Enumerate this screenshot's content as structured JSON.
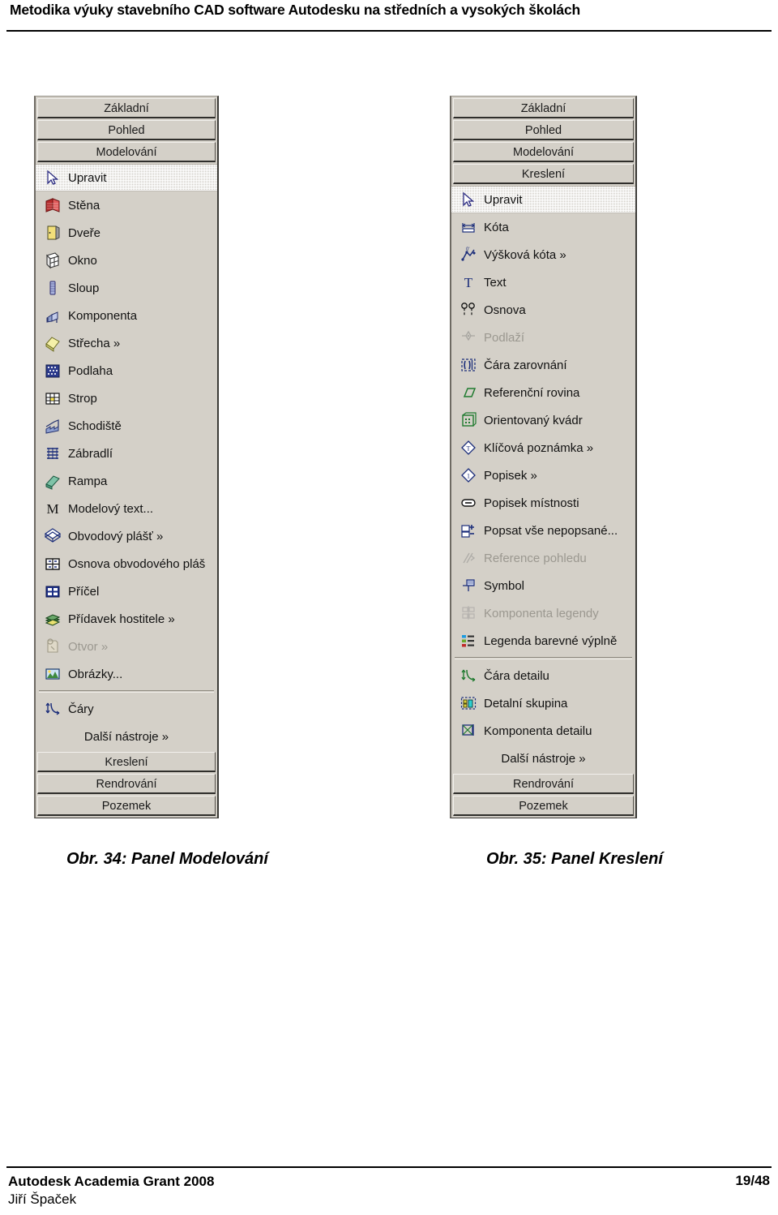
{
  "header": {
    "title": "Metodika výuky stavebního CAD software Autodesku na středních a vysokých školách"
  },
  "figures": [
    {
      "caption": "Obr. 34: Panel Modelování",
      "top_tabs": [
        "Základní",
        "Pohled",
        "Modelování"
      ],
      "bottom_tabs": [
        "Kreslení",
        "Rendrování",
        "Pozemek"
      ],
      "items": [
        {
          "label": "Upravit",
          "icon": "cursor-arrow-icon",
          "state": "selected"
        },
        {
          "label": "Stěna",
          "icon": "wall-icon",
          "state": "normal"
        },
        {
          "label": "Dveře",
          "icon": "door-icon",
          "state": "normal"
        },
        {
          "label": "Okno",
          "icon": "window-icon",
          "state": "normal"
        },
        {
          "label": "Sloup",
          "icon": "column-icon",
          "state": "normal"
        },
        {
          "label": "Komponenta",
          "icon": "component-icon",
          "state": "normal"
        },
        {
          "label": "Střecha »",
          "icon": "roof-icon",
          "state": "normal"
        },
        {
          "label": "Podlaha",
          "icon": "floor-icon",
          "state": "normal"
        },
        {
          "label": "Strop",
          "icon": "ceiling-icon",
          "state": "normal"
        },
        {
          "label": "Schodiště",
          "icon": "stairs-icon",
          "state": "normal"
        },
        {
          "label": "Zábradlí",
          "icon": "railing-icon",
          "state": "normal"
        },
        {
          "label": "Rampa",
          "icon": "ramp-icon",
          "state": "normal"
        },
        {
          "label": "Modelový text...",
          "icon": "model-text-icon",
          "state": "normal"
        },
        {
          "label": "Obvodový plášť »",
          "icon": "curtain-wall-icon",
          "state": "normal"
        },
        {
          "label": "Osnova obvodového pláš",
          "icon": "curtain-grid-icon",
          "state": "normal"
        },
        {
          "label": "Příčel",
          "icon": "mullion-icon",
          "state": "normal"
        },
        {
          "label": "Přídavek hostitele »",
          "icon": "host-sweep-icon",
          "state": "normal"
        },
        {
          "label": "Otvor »",
          "icon": "opening-icon",
          "state": "disabled"
        },
        {
          "label": "Obrázky...",
          "icon": "image-icon",
          "state": "normal"
        },
        {
          "label": "separator",
          "icon": "separator",
          "state": "separator"
        },
        {
          "label": "Čáry",
          "icon": "lines-icon",
          "state": "normal"
        },
        {
          "label": "Další nástroje »",
          "icon": "none",
          "state": "center"
        }
      ]
    },
    {
      "caption": "Obr. 35: Panel Kreslení",
      "top_tabs": [
        "Základní",
        "Pohled",
        "Modelování",
        "Kreslení"
      ],
      "bottom_tabs": [
        "Rendrování",
        "Pozemek"
      ],
      "items": [
        {
          "label": "Upravit",
          "icon": "cursor-arrow-icon",
          "state": "selected"
        },
        {
          "label": "Kóta",
          "icon": "dimension-icon",
          "state": "normal"
        },
        {
          "label": "Výšková kóta »",
          "icon": "spot-elevation-icon",
          "state": "normal"
        },
        {
          "label": "Text",
          "icon": "text-icon",
          "state": "normal"
        },
        {
          "label": "Osnova",
          "icon": "grid-icon",
          "state": "normal"
        },
        {
          "label": "Podlaží",
          "icon": "level-icon",
          "state": "disabled"
        },
        {
          "label": "Čára zarovnání",
          "icon": "alignment-line-icon",
          "state": "normal"
        },
        {
          "label": "Referenční rovina",
          "icon": "reference-plane-icon",
          "state": "normal"
        },
        {
          "label": "Orientovaný kvádr",
          "icon": "scope-box-icon",
          "state": "normal"
        },
        {
          "label": "Klíčová poznámka »",
          "icon": "keynote-icon",
          "state": "normal"
        },
        {
          "label": "Popisek »",
          "icon": "tag-icon",
          "state": "normal"
        },
        {
          "label": "Popisek místnosti",
          "icon": "room-tag-icon",
          "state": "normal"
        },
        {
          "label": "Popsat vše nepopsané...",
          "icon": "tag-all-icon",
          "state": "normal"
        },
        {
          "label": "Reference pohledu",
          "icon": "view-reference-icon",
          "state": "disabled"
        },
        {
          "label": "Symbol",
          "icon": "symbol-icon",
          "state": "normal"
        },
        {
          "label": "Komponenta legendy",
          "icon": "legend-component-icon",
          "state": "disabled"
        },
        {
          "label": "Legenda barevné výplně",
          "icon": "color-fill-legend-icon",
          "state": "normal"
        },
        {
          "label": "separator",
          "icon": "separator",
          "state": "separator"
        },
        {
          "label": "Čára detailu",
          "icon": "detail-line-icon",
          "state": "normal"
        },
        {
          "label": "Detalní skupina",
          "icon": "detail-group-icon",
          "state": "normal"
        },
        {
          "label": "Komponenta detailu",
          "icon": "detail-component-icon",
          "state": "normal"
        },
        {
          "label": "Další nástroje »",
          "icon": "none",
          "state": "center"
        }
      ]
    }
  ],
  "footer": {
    "line1": "Autodesk Academia Grant 2008",
    "line2": "Jiří Špaček",
    "page": "19/48"
  }
}
